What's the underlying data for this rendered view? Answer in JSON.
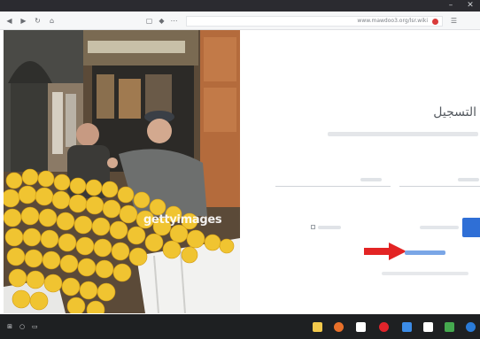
{
  "window": {
    "minimize_glyph": "–",
    "close_glyph": "✕"
  },
  "browser": {
    "url": "www.mawdoo3.org/lsr.wiki",
    "colors": {
      "toolbar": "#f6f7f8",
      "address_bg": "#ffffff"
    }
  },
  "photo": {
    "watermark": "gettyimages",
    "watermark_sub": ""
  },
  "login": {
    "heading": "التسجيل",
    "button_color": "#2f6fd6",
    "link_color": "#7aa6e6"
  },
  "annotation": {
    "arrow_color": "#e32424"
  },
  "taskbar": {
    "icons": [
      {
        "name": "start-icon",
        "color": "#ffffff"
      },
      {
        "name": "search-icon",
        "color": "#d7d9dc"
      },
      {
        "name": "task-view-icon",
        "color": "#d7d9dc"
      },
      {
        "name": "file-explorer-icon",
        "color": "#f2c94c"
      },
      {
        "name": "firefox-icon",
        "color": "#e8702a"
      },
      {
        "name": "files-icon",
        "color": "#ffffff"
      },
      {
        "name": "store-icon",
        "color": "#ffffff"
      },
      {
        "name": "opera-icon",
        "color": "#e0242b"
      },
      {
        "name": "photos-icon",
        "color": "#3c8ce7"
      },
      {
        "name": "mail-icon",
        "color": "#ffffff"
      },
      {
        "name": "media-icon",
        "color": "#45a94f"
      },
      {
        "name": "app-icon",
        "color": "#2a7bd8"
      }
    ]
  }
}
